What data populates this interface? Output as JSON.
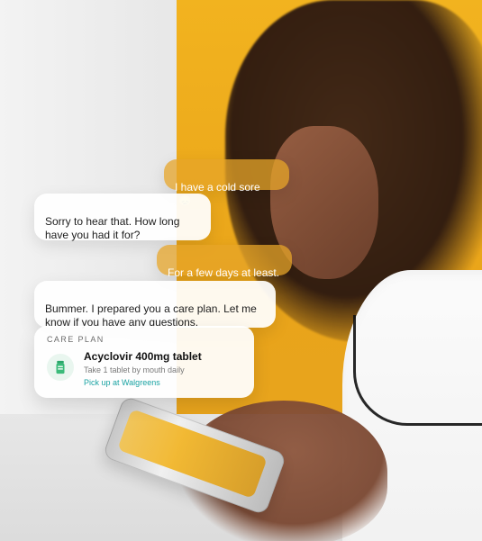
{
  "chat": {
    "messages": [
      {
        "role": "user",
        "text": "I have a cold sore",
        "emoji": "😞"
      },
      {
        "role": "assistant",
        "text": "Sorry to hear that. How long\nhave you had it for?"
      },
      {
        "role": "user",
        "text": "For a few days at least."
      },
      {
        "role": "assistant",
        "text": "Bummer. I prepared you a care plan. Let me\nknow if you have any questions."
      }
    ]
  },
  "care_plan": {
    "label": "CARE PLAN",
    "medication": "Acyclovir 400mg tablet",
    "instructions": "Take 1 tablet by mouth daily",
    "pickup_text": "Pick up at Walgreens",
    "icon": "pill-bottle-icon"
  },
  "colors": {
    "user_bubble": "#e5a428",
    "assistant_bubble": "#ffffff",
    "accent_link": "#1aa3a3",
    "background_panel": "#f2b31f"
  }
}
